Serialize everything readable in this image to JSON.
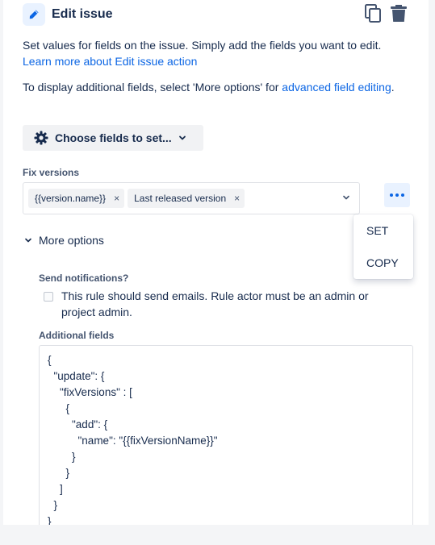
{
  "header": {
    "title": "Edit issue",
    "icons": [
      "pencil-icon",
      "copy-icon",
      "trash-icon"
    ]
  },
  "description": {
    "text1": "Set values for fields on the issue. Simply add the fields you want to edit. ",
    "link1": "Learn more about Edit issue action",
    "text2": "To display additional fields, select 'More options' for ",
    "link2": "advanced field editing",
    "text2_end": "."
  },
  "choose_fields": {
    "label": "Choose fields to set...",
    "icon": "gear-icon"
  },
  "fix_versions": {
    "label": "Fix versions",
    "chips": [
      {
        "label": "{{version.name}}",
        "remove": "×"
      },
      {
        "label": "Last released version",
        "remove": "×"
      }
    ]
  },
  "more_menu": {
    "items": [
      "SET",
      "COPY"
    ]
  },
  "more_options": {
    "label": "More options"
  },
  "send_notifications": {
    "label": "Send notifications?",
    "checkbox_text": "This rule should send emails. Rule actor must be an admin or project admin.",
    "checked": false
  },
  "additional_fields": {
    "label": "Additional fields",
    "lines": [
      "{",
      "  \"update\": {",
      "    \"fixVersions\" : [",
      "      {",
      "        \"add\": {",
      "          \"name\": \"{{fixVersionName}}\"",
      "        }",
      "      }",
      "    ]",
      "  }",
      "}"
    ]
  },
  "colors": {
    "link": "#0c66e4",
    "text": "#172b4d",
    "accent_bg": "#e9f2ff"
  }
}
